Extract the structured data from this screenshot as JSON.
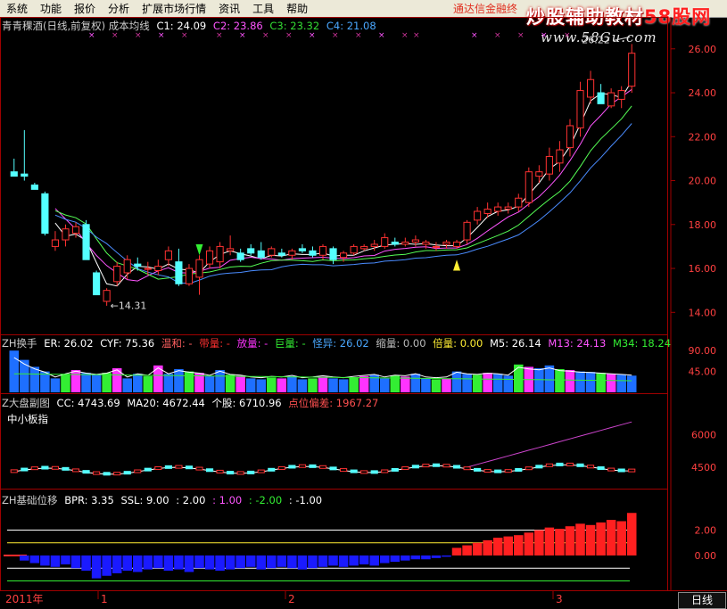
{
  "menu": [
    "系统",
    "功能",
    "报价",
    "分析",
    "扩展市场行情",
    "资讯",
    "工具",
    "帮助"
  ],
  "notice": "通达信金融终",
  "watermark": {
    "text": "炒股辅助教材",
    "brand": "58股网",
    "url": "www.58Gu.com"
  },
  "main_chart": {
    "title": "青青稞酒(日线,前复权) 成本均线",
    "c1_label": "C1: 24.09",
    "c2_label": "C2: 23.86",
    "c3_label": "C3: 23.32",
    "c4_label": "C4: 21.08",
    "y_ticks": [
      "26.00",
      "24.00",
      "22.00",
      "20.00",
      "18.00",
      "16.00",
      "14.00"
    ],
    "high_label": "26.22",
    "low_label": "14.31"
  },
  "turnover": {
    "title": "ZH换手",
    "er": "ER: 26.02",
    "cyf": "CYF: 75.36",
    "mild": "温和: -",
    "double": "带量: -",
    "volume": "放量: -",
    "huge": "巨量: -",
    "odd": "怪异: 26.02",
    "shrink": "缩量: 0.00",
    "multi": "倍量: 0.00",
    "m5": "M5: 26.14",
    "m13": "M13: 24.13",
    "m34": "M34: 18.24",
    "y_ticks": [
      "90.00",
      "45.00"
    ]
  },
  "market": {
    "title": "Z大盘副图",
    "cc": "CC: 4743.69",
    "ma20": "MA20: 4672.44",
    "stock": "个股: 6710.96",
    "dev": "点位偏差: 1967.27",
    "index_name": "中小板指",
    "y_ticks": [
      "6000",
      "4500"
    ]
  },
  "basis": {
    "title": "ZH基础位移",
    "bpr": "BPR: 3.35",
    "ssl1": "SSL: 9.00",
    "ssl2": ": 2.00",
    "ssl3": ": 1.00",
    "ssl4": ": -2.00",
    "ssl5": ": -1.00",
    "y_ticks": [
      "2.00",
      "0.00"
    ]
  },
  "time_axis": {
    "year": "2011年",
    "m1": "1",
    "m2": "2",
    "m3": "3"
  },
  "period_tab": "日线",
  "chart_data": {
    "type": "candlestick",
    "ylim": [
      13.2,
      26.6
    ],
    "candles": [
      [
        20.4,
        21.0,
        20.2,
        20.2
      ],
      [
        20.3,
        22.3,
        20.0,
        20.2
      ],
      [
        19.8,
        19.9,
        19.6,
        19.6
      ],
      [
        19.4,
        19.5,
        17.5,
        17.6
      ],
      [
        17.0,
        17.7,
        16.8,
        17.3
      ],
      [
        17.3,
        18.0,
        17.0,
        17.8
      ],
      [
        17.6,
        18.1,
        17.4,
        17.9
      ],
      [
        18.0,
        18.2,
        16.4,
        16.4
      ],
      [
        15.8,
        15.9,
        14.8,
        14.8
      ],
      [
        14.5,
        15.1,
        14.3,
        15.0
      ],
      [
        15.4,
        16.3,
        15.2,
        16.1
      ],
      [
        15.8,
        16.6,
        15.5,
        16.4
      ],
      [
        16.2,
        16.5,
        15.9,
        16.1
      ],
      [
        16.0,
        16.3,
        15.7,
        16.0
      ],
      [
        15.9,
        16.4,
        15.7,
        16.1
      ],
      [
        16.4,
        17.0,
        16.1,
        16.8
      ],
      [
        16.3,
        16.9,
        15.2,
        15.3
      ],
      [
        15.3,
        16.2,
        15.2,
        16.0
      ],
      [
        15.6,
        16.6,
        14.8,
        16.4
      ],
      [
        16.2,
        17.0,
        16.0,
        16.8
      ],
      [
        16.3,
        17.2,
        16.0,
        17.0
      ],
      [
        16.8,
        17.5,
        16.6,
        16.9
      ],
      [
        16.7,
        16.9,
        16.3,
        16.4
      ],
      [
        16.9,
        17.1,
        16.6,
        16.7
      ],
      [
        16.8,
        17.2,
        16.4,
        16.5
      ],
      [
        16.6,
        17.0,
        16.5,
        16.9
      ],
      [
        16.7,
        16.9,
        16.5,
        16.6
      ],
      [
        16.6,
        16.9,
        16.4,
        16.8
      ],
      [
        16.9,
        17.1,
        16.7,
        16.8
      ],
      [
        16.8,
        17.0,
        16.5,
        16.6
      ],
      [
        16.6,
        17.1,
        16.4,
        17.0
      ],
      [
        16.9,
        17.0,
        16.2,
        16.4
      ],
      [
        16.5,
        16.8,
        16.3,
        16.7
      ],
      [
        16.7,
        17.1,
        16.6,
        17.0
      ],
      [
        16.9,
        17.1,
        16.8,
        17.0
      ],
      [
        17.0,
        17.3,
        16.8,
        17.1
      ],
      [
        17.0,
        17.6,
        16.9,
        17.4
      ],
      [
        17.2,
        17.4,
        17.0,
        17.1
      ],
      [
        17.1,
        17.4,
        17.0,
        17.2
      ],
      [
        17.2,
        17.5,
        17.0,
        17.3
      ],
      [
        17.1,
        17.3,
        16.9,
        17.2
      ],
      [
        17.0,
        17.2,
        16.8,
        17.0
      ],
      [
        17.1,
        17.3,
        16.9,
        17.2
      ],
      [
        17.0,
        17.3,
        16.9,
        17.2
      ],
      [
        17.3,
        18.2,
        17.1,
        18.1
      ],
      [
        18.2,
        18.8,
        18.0,
        18.6
      ],
      [
        18.5,
        19.0,
        18.3,
        18.7
      ],
      [
        18.6,
        19.0,
        18.4,
        18.8
      ],
      [
        18.7,
        19.0,
        18.5,
        18.8
      ],
      [
        18.8,
        19.4,
        18.6,
        19.2
      ],
      [
        19.0,
        20.6,
        18.8,
        20.4
      ],
      [
        20.2,
        20.7,
        19.9,
        20.4
      ],
      [
        20.3,
        21.5,
        20.0,
        21.1
      ],
      [
        20.8,
        21.8,
        20.4,
        21.4
      ],
      [
        21.5,
        22.8,
        21.1,
        22.5
      ],
      [
        22.4,
        24.5,
        22.0,
        24.1
      ],
      [
        23.8,
        25.0,
        23.5,
        24.6
      ],
      [
        24.0,
        24.4,
        23.5,
        23.5
      ],
      [
        23.4,
        24.2,
        23.3,
        24.0
      ],
      [
        23.7,
        24.3,
        23.3,
        24.1
      ],
      [
        24.3,
        26.22,
        24.0,
        25.8
      ]
    ],
    "turnover": [
      90,
      70,
      55,
      45,
      30,
      40,
      48,
      42,
      38,
      42,
      52,
      30,
      40,
      35,
      58,
      40,
      50,
      45,
      42,
      35,
      48,
      38,
      36,
      30,
      28,
      32,
      30,
      35,
      28,
      30,
      34,
      30,
      28,
      32,
      35,
      38,
      30,
      36,
      34,
      40,
      30,
      28,
      30,
      45,
      40,
      38,
      42,
      40,
      36,
      60,
      55,
      52,
      58,
      50,
      48,
      45,
      44,
      42,
      40,
      38,
      36
    ],
    "basis": [
      0,
      -0.4,
      -0.6,
      -0.8,
      -0.9,
      -0.7,
      -1.0,
      -1.2,
      -1.8,
      -1.6,
      -1.4,
      -1.2,
      -1.3,
      -1.1,
      -1.0,
      -1.2,
      -1.1,
      -1.3,
      -1.0,
      -1.1,
      -1.2,
      -1.1,
      -1.0,
      -0.9,
      -1.1,
      -1.0,
      -0.9,
      -1.0,
      -1.1,
      -1.0,
      -0.9,
      -0.8,
      -0.9,
      -0.8,
      -0.7,
      -0.8,
      -0.6,
      -0.5,
      -0.4,
      -0.3,
      -0.3,
      -0.2,
      -0.1,
      0.6,
      0.8,
      1.0,
      1.2,
      1.4,
      1.5,
      1.6,
      1.8,
      2.0,
      2.2,
      2.1,
      2.3,
      2.5,
      2.4,
      2.6,
      2.8,
      2.7,
      3.35
    ]
  }
}
